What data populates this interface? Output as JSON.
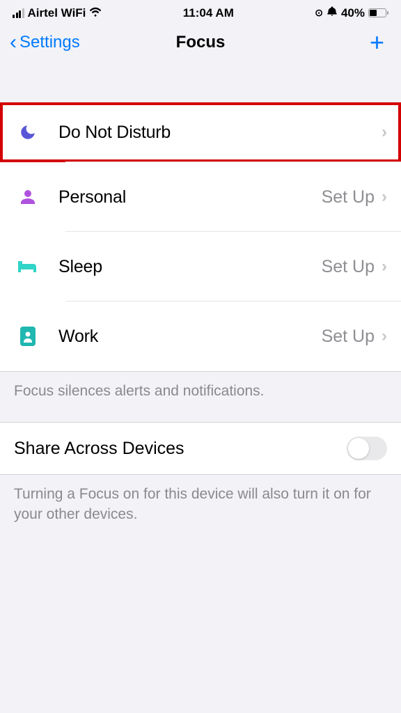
{
  "statusBar": {
    "carrier": "Airtel WiFi",
    "time": "11:04 AM",
    "battery": "40%"
  },
  "nav": {
    "back": "Settings",
    "title": "Focus"
  },
  "focusModes": [
    {
      "label": "Do Not Disturb",
      "trail": "",
      "iconColor": "#5856d6"
    },
    {
      "label": "Personal",
      "trail": "Set Up",
      "iconColor": "#af52de"
    },
    {
      "label": "Sleep",
      "trail": "Set Up",
      "iconColor": "#30d5c8"
    },
    {
      "label": "Work",
      "trail": "Set Up",
      "iconColor": "#1fb7b0"
    }
  ],
  "footer1": "Focus silences alerts and notifications.",
  "shareRow": "Share Across Devices",
  "footer2": "Turning a Focus on for this device will also turn it on for your other devices."
}
